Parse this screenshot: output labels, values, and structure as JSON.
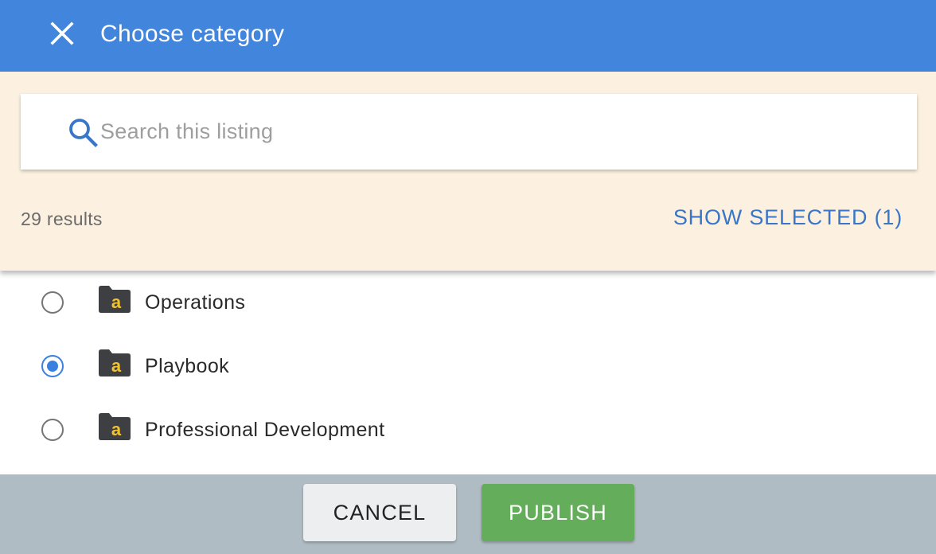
{
  "header": {
    "title": "Choose category",
    "close_icon": "close-icon"
  },
  "search": {
    "placeholder": "Search this listing",
    "value": "",
    "icon": "search-icon"
  },
  "results": {
    "count_text": "29 results",
    "show_selected_label": "SHOW SELECTED (1)"
  },
  "list": {
    "items": [
      {
        "label": "Operations",
        "selected": false,
        "icon": "folder-icon"
      },
      {
        "label": "Playbook",
        "selected": true,
        "icon": "folder-icon"
      },
      {
        "label": "Professional Development",
        "selected": false,
        "icon": "folder-icon"
      }
    ]
  },
  "footer": {
    "cancel_label": "CANCEL",
    "publish_label": "PUBLISH"
  },
  "colors": {
    "header_bg": "#4285dc",
    "search_panel_bg": "#fcf1e0",
    "accent_blue": "#3a76c8",
    "publish_green": "#64ad5a",
    "footer_bg": "#b0bcc3",
    "folder_dark": "#3d3f43",
    "folder_letter": "#f3c22f"
  }
}
